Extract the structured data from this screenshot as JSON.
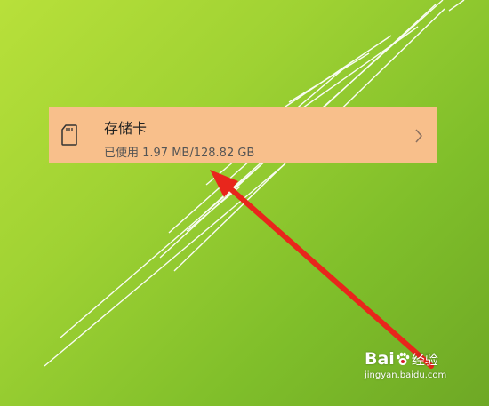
{
  "storage_item": {
    "title": "存储卡",
    "usage": "已使用 1.97 MB/128.82 GB",
    "icon": "sd-card-icon"
  },
  "watermark": {
    "brand_latin": "Bai",
    "brand_cn": "经验",
    "url": "jingyan.baidu.com"
  },
  "colors": {
    "background_light": "#b8e03a",
    "background_dark": "#6ea825",
    "card_highlight": "#f8bf8b",
    "arrow": "#e8261c"
  }
}
